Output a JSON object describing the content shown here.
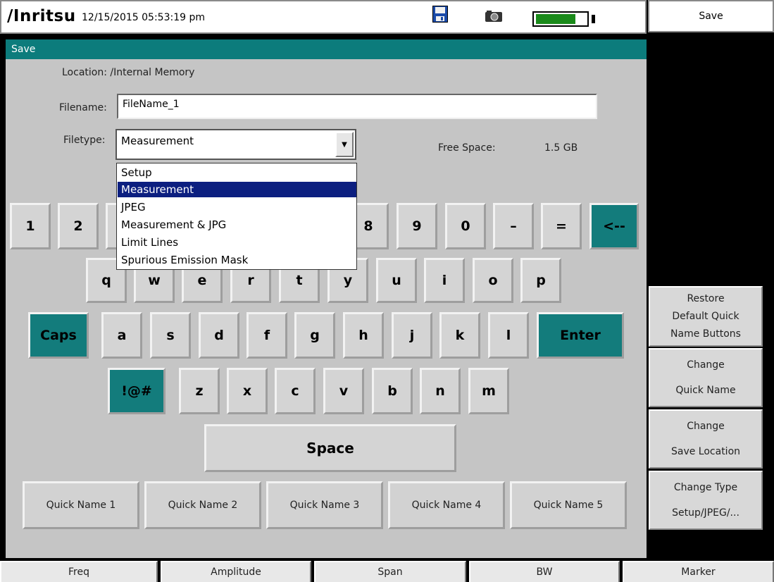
{
  "status_bar": {
    "brand": "/Inritsu",
    "datetime": "12/15/2015 05:53:19 pm",
    "battery_level": 0.78,
    "icons": [
      "floppy-disk-icon",
      "camera-icon",
      "battery-icon"
    ]
  },
  "dialog": {
    "title": "Save",
    "location": "Location: /Internal Memory",
    "filename_label": "Filename:",
    "filename_value": "FileName_1",
    "filetype_label": "Filetype:",
    "filetype_value": "Measurement",
    "free_space_label": "Free Space:",
    "free_space_value": "1.5 GB",
    "filetype_options": [
      "Setup",
      "Measurement",
      "JPEG",
      "Measurement & JPG",
      "Limit Lines",
      "Spurious Emission Mask"
    ],
    "selected_option_index": 1
  },
  "keyboard": {
    "row1": [
      "1",
      "2",
      "8",
      "9",
      "0",
      "–",
      "=",
      "<--"
    ],
    "row2": [
      "q",
      "w",
      "e",
      "r",
      "t",
      "y",
      "u",
      "i",
      "o",
      "p"
    ],
    "row3": [
      "Caps",
      "a",
      "s",
      "d",
      "f",
      "g",
      "h",
      "j",
      "k",
      "l",
      "Enter"
    ],
    "row4": [
      "!@#",
      "z",
      "x",
      "c",
      "v",
      "b",
      "n",
      "m"
    ],
    "space": "Space",
    "quick_names": [
      "Quick Name 1",
      "Quick Name 2",
      "Quick Name 3",
      "Quick Name 4",
      "Quick Name 5"
    ]
  },
  "softkeys": {
    "title": "Save",
    "items": [
      {
        "line1": "Restore",
        "line2": "Default Quick",
        "line3": "Name Buttons"
      },
      {
        "line1": "Change",
        "line2": "Quick Name"
      },
      {
        "line1": "Change",
        "line2": "Save Location"
      },
      {
        "line1": "Change Type",
        "line2": "Setup/JPEG/..."
      }
    ]
  },
  "bottom_tabs": [
    "Freq",
    "Amplitude",
    "Span",
    "BW",
    "Marker"
  ],
  "colors": {
    "teal": "#0c7c7c",
    "dialog_bg": "#c5c5c5",
    "selected_bg": "#0c1f80"
  }
}
